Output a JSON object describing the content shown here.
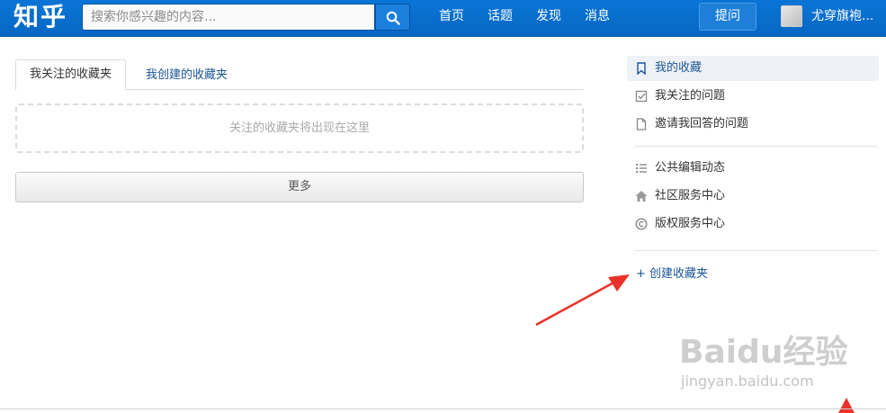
{
  "header": {
    "logo": "知乎",
    "search_placeholder": "搜索你感兴趣的内容...",
    "nav": [
      "首页",
      "话题",
      "发现",
      "消息"
    ],
    "ask_label": "提问",
    "username": "尤穿旗袍..."
  },
  "main": {
    "tabs": [
      {
        "label": "我关注的收藏夹",
        "active": true
      },
      {
        "label": "我创建的收藏夹",
        "active": false
      }
    ],
    "empty_message": "关注的收藏夹将出现在这里",
    "more_label": "更多"
  },
  "sidebar": {
    "group1": [
      {
        "label": "我的收藏",
        "icon": "bookmark-icon",
        "active": true
      },
      {
        "label": "我关注的问题",
        "icon": "checkbox-icon"
      },
      {
        "label": "邀请我回答的问题",
        "icon": "document-icon"
      }
    ],
    "group2": [
      {
        "label": "公共编辑动态",
        "icon": "list-icon"
      },
      {
        "label": "社区服务中心",
        "icon": "home-icon"
      },
      {
        "label": "版权服务中心",
        "icon": "copyright-icon"
      }
    ],
    "create_label": "+ 创建收藏夹"
  },
  "watermark": {
    "brand": "Baidu经验",
    "site": "jingyan.baidu.com"
  },
  "colors": {
    "topbar": "#0767c3",
    "link": "#1c5597",
    "annotation_arrow": "#e8332a"
  }
}
